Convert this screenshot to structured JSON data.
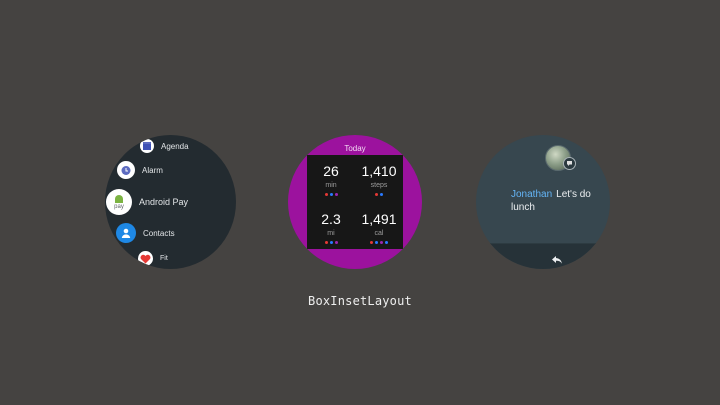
{
  "app_list": {
    "items": [
      {
        "label": "Agenda",
        "icon": "calendar-icon"
      },
      {
        "label": "Alarm",
        "icon": "alarm-icon"
      },
      {
        "label": "Android Pay",
        "icon": "android-pay-icon",
        "icon_text": "pay"
      },
      {
        "label": "Contacts",
        "icon": "contacts-icon"
      },
      {
        "label": "Fit",
        "icon": "heart-icon"
      }
    ]
  },
  "fit": {
    "header": "Today",
    "stats": [
      {
        "value": "26",
        "unit": "min"
      },
      {
        "value": "1,410",
        "unit": "steps"
      },
      {
        "value": "2.3",
        "unit": "mi"
      },
      {
        "value": "1,491",
        "unit": "cal"
      }
    ],
    "colors": {
      "ring": "#9c129e",
      "dot_red": "#e53935",
      "dot_blue": "#2979ff",
      "dot_purple": "#9c27b0"
    }
  },
  "message": {
    "sender": "Jonathan",
    "text": "Let's do lunch",
    "sender_color": "#64b5f6"
  },
  "caption": "BoxInsetLayout"
}
